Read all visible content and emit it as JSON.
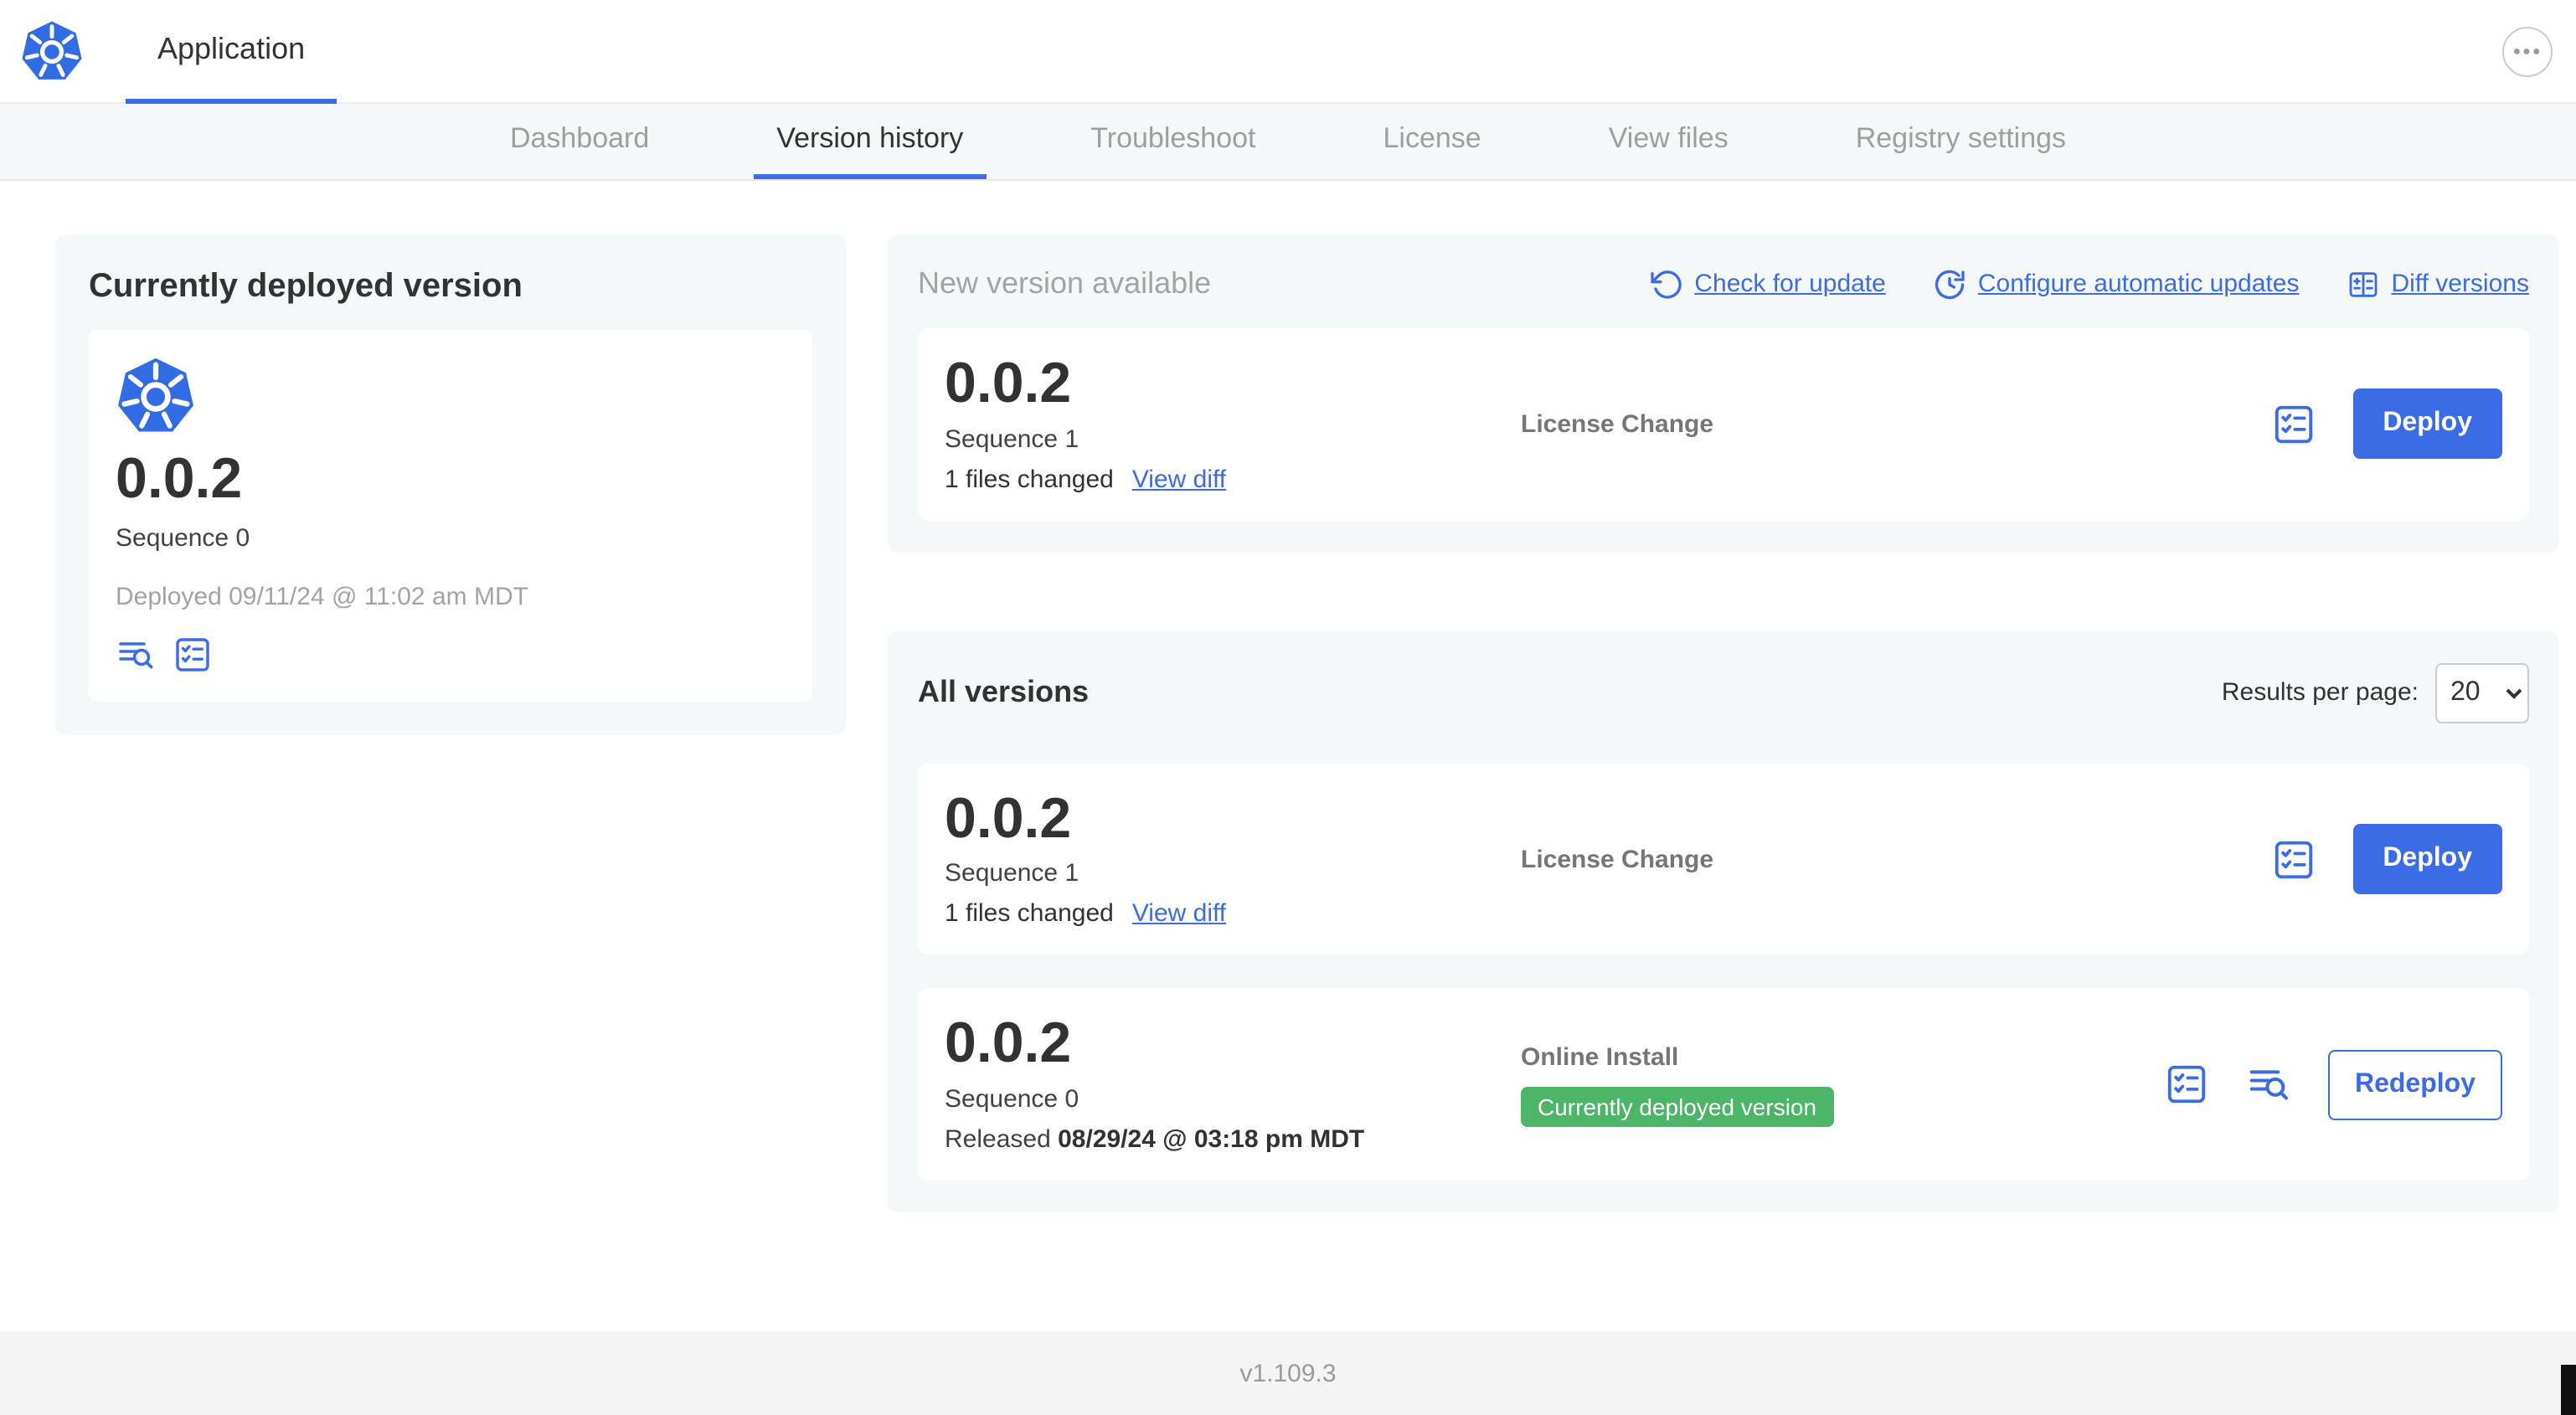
{
  "header": {
    "app_tab": "Application",
    "menu_glyph": "●●●"
  },
  "nav": {
    "tabs": [
      {
        "label": "Dashboard",
        "active": false
      },
      {
        "label": "Version history",
        "active": true
      },
      {
        "label": "Troubleshoot",
        "active": false
      },
      {
        "label": "License",
        "active": false
      },
      {
        "label": "View files",
        "active": false
      },
      {
        "label": "Registry settings",
        "active": false
      }
    ]
  },
  "current_version": {
    "heading": "Currently deployed version",
    "version": "0.0.2",
    "sequence": "Sequence 0",
    "deployed": "Deployed 09/11/24 @ 11:02 am MDT"
  },
  "new_version": {
    "heading": "New version available",
    "actions": [
      {
        "label": "Check for update",
        "icon": "refresh-ccw-icon"
      },
      {
        "label": "Configure automatic updates",
        "icon": "update-clock-icon"
      },
      {
        "label": "Diff versions",
        "icon": "diff-table-icon"
      }
    ],
    "release": {
      "version": "0.0.2",
      "sequence": "Sequence 1",
      "files_changed": "1 files changed",
      "view_diff_label": "View diff",
      "source": "License Change",
      "deploy_label": "Deploy"
    }
  },
  "all_versions": {
    "heading": "All versions",
    "results_per_page_label": "Results per page:",
    "results_per_page": "20",
    "rows": [
      {
        "version": "0.0.2",
        "sequence": "Sequence 1",
        "files_changed": "1 files changed",
        "view_diff_label": "View diff",
        "source": "License Change",
        "action_label": "Deploy"
      },
      {
        "version": "0.0.2",
        "sequence": "Sequence 0",
        "released_prefix": "Released",
        "released_date": "08/29/24 @ 03:18 pm MDT",
        "source": "Online Install",
        "badge": "Currently deployed version",
        "action_label": "Redeploy"
      }
    ]
  },
  "footer": {
    "version": "v1.109.3"
  },
  "colors": {
    "accent_blue": "#3b6ce5",
    "kubernetes_blue": "#326ce5",
    "badge_green": "#4cb567",
    "card_bg": "#f5f8f9",
    "muted_text": "#9b9b9b"
  },
  "icons": {
    "logo": "kubernetes-logo-icon",
    "menu": "ellipsis-icon",
    "preflight": "checklist-icon",
    "logs": "file-logs-icon",
    "check_update": "refresh-ccw-icon",
    "auto_update": "update-clock-icon",
    "diff": "diff-table-icon"
  }
}
